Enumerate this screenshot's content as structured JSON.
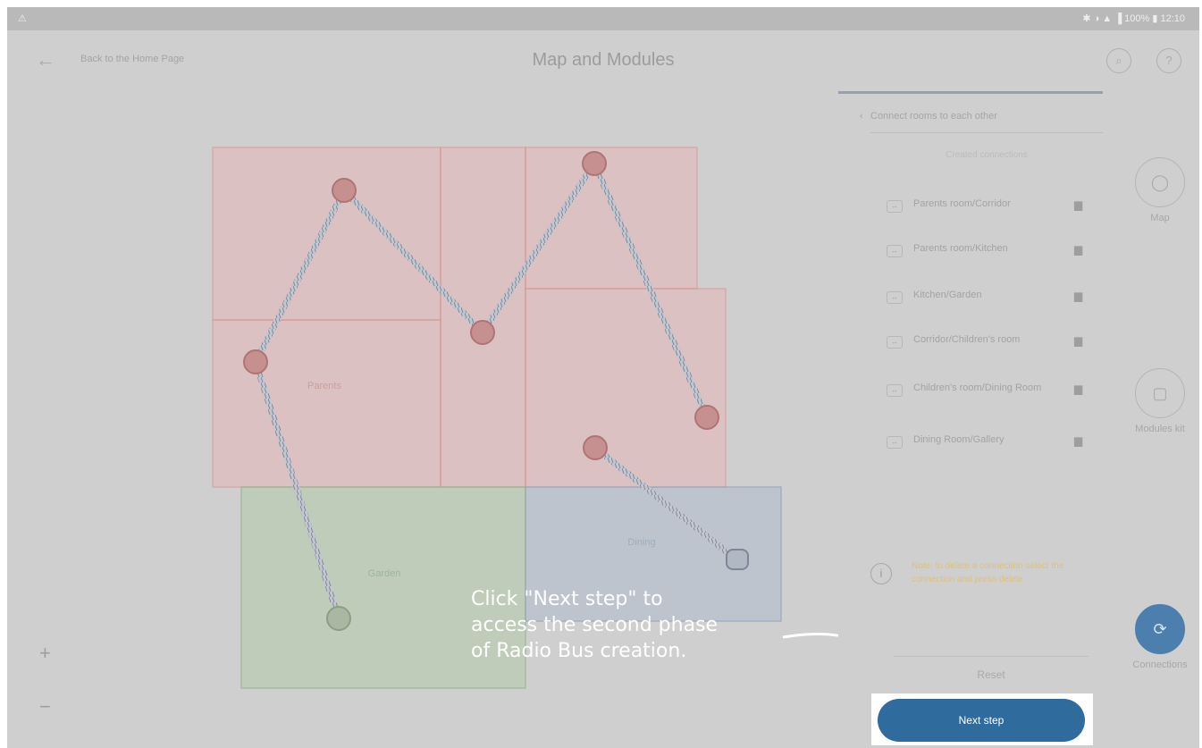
{
  "statusbar": {
    "left": "⚠",
    "right": "✱ ◑ ▲ ▐ 100% ▮ 12:10"
  },
  "header": {
    "back_icon": "arrow-left-icon",
    "back_label": "Back to the Home Page",
    "title": "Map and Modules",
    "search_icon": "search-icon",
    "help_icon": "help-icon"
  },
  "map": {
    "rooms": [
      {
        "name": "",
        "color": "#e6b7b7"
      },
      {
        "name": "",
        "color": "#e6b7b7"
      },
      {
        "name": "",
        "color": "#e6b7b7"
      },
      {
        "name": "Parents",
        "color": "#e6b7b7"
      },
      {
        "name": "",
        "color": "#e6b7b7"
      },
      {
        "name": "Garden",
        "color": "#b7cbb1"
      },
      {
        "name": "Dining",
        "color": "#b8c1cd"
      }
    ],
    "zoom_in": "+",
    "zoom_out": "−"
  },
  "panel": {
    "chevron": "‹",
    "header": "Connect rooms to each other",
    "subheader": "Created connections",
    "connections": [
      {
        "label": "Parents room/Corridor",
        "icon": "↔"
      },
      {
        "label": "Parents room/Kitchen",
        "icon": "↔"
      },
      {
        "label": "Kitchen/Garden",
        "icon": "↔"
      },
      {
        "label": "Corridor/Children's room",
        "icon": "↔"
      },
      {
        "label": "Children's room/Dining Room",
        "icon": "↔"
      },
      {
        "label": "Dining Room/Gallery",
        "icon": "↔"
      }
    ],
    "delete_icon": "trash-icon",
    "info_icon": "info-icon",
    "info_text": "Note: to delete a connection select the connection and press delete",
    "reset_label": "Reset",
    "next_label": "Next step"
  },
  "side_tools": [
    {
      "label": "Map",
      "icon": "map-icon",
      "glyph": "◯",
      "active": false
    },
    {
      "label": "Modules kit",
      "icon": "modules-icon",
      "glyph": "▢",
      "active": false
    },
    {
      "label": "Connections",
      "icon": "connections-icon",
      "glyph": "⟳",
      "active": true
    }
  ],
  "callout": {
    "line1": "Click \"Next step\" to",
    "line2": "access the second phase",
    "line3": "of Radio Bus creation."
  },
  "colors": {
    "accent": "#2f6b9c",
    "overlay": "#cfcfcf",
    "wire": "#8a94a8",
    "node": "#c88f8f"
  }
}
